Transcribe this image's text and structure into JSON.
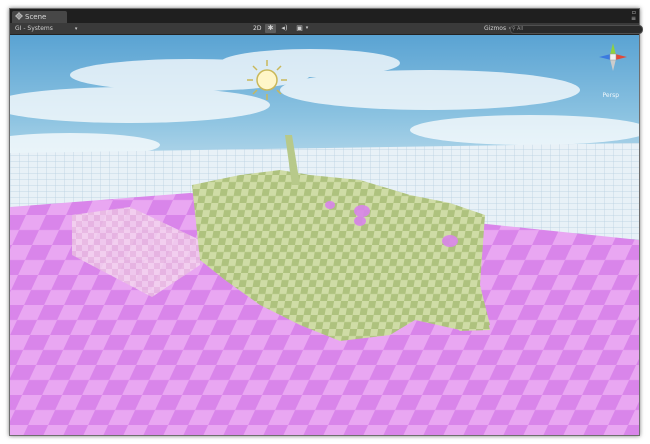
{
  "tab": {
    "label": "Scene",
    "icon": "scene-icon"
  },
  "window_controls": {
    "restore": "▫",
    "options": "≡"
  },
  "toolbar": {
    "draw_mode": "GI - Systems",
    "mode_2d": "2D",
    "lighting_icon": "sun-icon",
    "audio_icon": "speaker-icon",
    "effects_icon": "image-icon",
    "gizmos_label": "Gizmos",
    "search_placeholder": "All"
  },
  "viewport": {
    "projection_label": "Persp",
    "colors": {
      "sky": "#7ab8d8",
      "ground_pink": "#e59ef0",
      "ground_pink_dark": "#d07fe0",
      "mesh_green": "#c5d49a",
      "mesh_green_dark": "#a9be78",
      "mesh_pink": "#f0cfe8",
      "grid": "#cfe1ef"
    }
  }
}
